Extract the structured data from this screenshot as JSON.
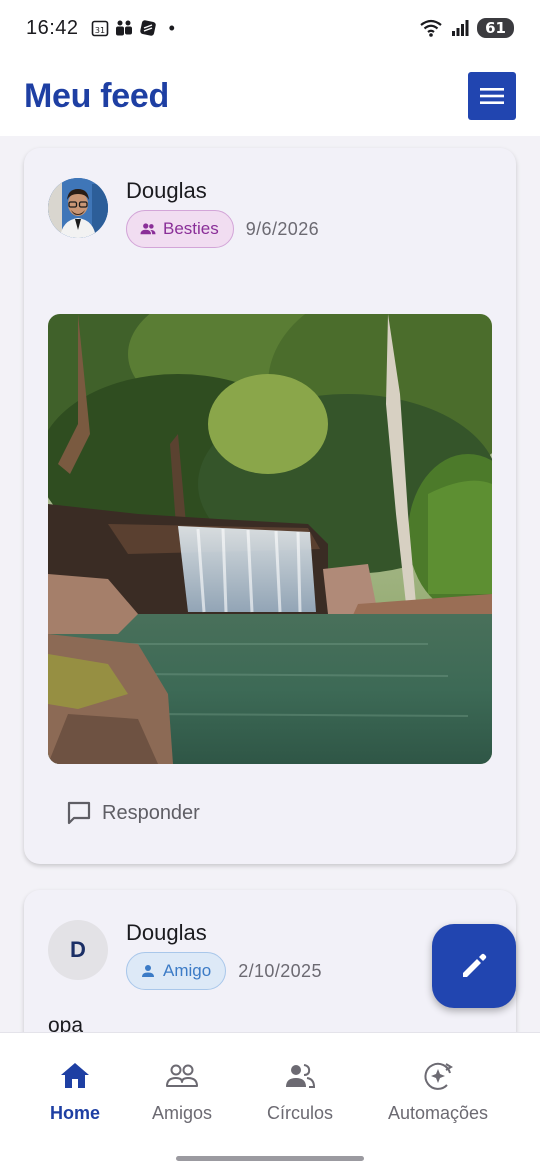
{
  "status_bar": {
    "time": "16:42",
    "dot": "•",
    "battery": "61",
    "icons": [
      "calendar-icon",
      "teams-icon",
      "app-icon",
      "wifi-icon",
      "signal-icon",
      "battery-icon"
    ]
  },
  "header": {
    "title": "Meu feed",
    "menu_icon": "hamburger-menu-icon"
  },
  "posts": [
    {
      "author": "Douglas",
      "avatar": "photo",
      "audience": "Besties",
      "audience_icon": "group-icon",
      "date": "9/6/2026",
      "image": "waterfall-landscape-photo",
      "reply_label": "Responder"
    },
    {
      "author": "Douglas",
      "avatar_initial": "D",
      "audience": "Amigo",
      "audience_icon": "person-icon",
      "date": "2/10/2025",
      "text": "opa"
    }
  ],
  "fab": {
    "icon": "edit-pencil-icon"
  },
  "bottom_nav": {
    "active": "Home",
    "items": [
      {
        "label": "Home",
        "icon": "home-icon"
      },
      {
        "label": "Amigos",
        "icon": "friends-icon"
      },
      {
        "label": "Círculos",
        "icon": "circles-group-icon"
      },
      {
        "label": "Automações",
        "icon": "automation-sparkle-icon"
      }
    ]
  },
  "colors": {
    "primary": "#1e3fa3",
    "besties_chip": "#8a2f98",
    "amigo_chip": "#3c7bc6",
    "background": "#f3f2f7"
  }
}
